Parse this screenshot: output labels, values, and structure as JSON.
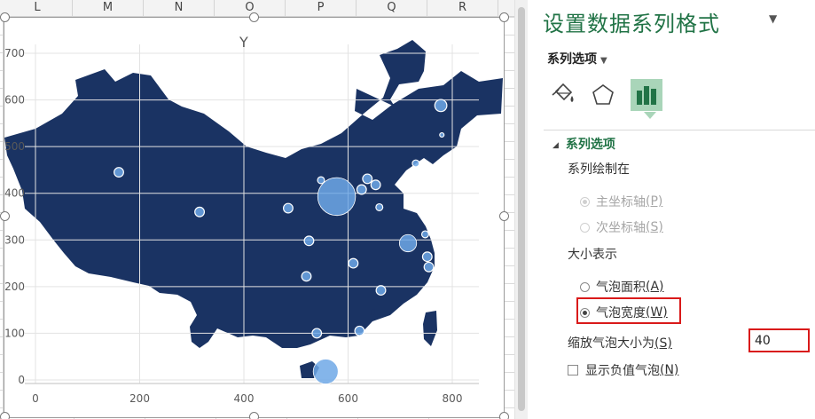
{
  "spreadsheet": {
    "column_headers": [
      "L",
      "M",
      "N",
      "O",
      "P",
      "Q",
      "R"
    ]
  },
  "chart": {
    "title": "Y"
  },
  "chart_data": {
    "type": "scatter",
    "title": "Y",
    "xlabel": "",
    "ylabel": "",
    "xlim": [
      0,
      800
    ],
    "ylim": [
      0,
      700
    ],
    "x_ticks": [
      "0",
      "200",
      "400",
      "600",
      "800"
    ],
    "y_ticks": [
      "0",
      "100",
      "200",
      "300",
      "400",
      "500",
      "600",
      "700"
    ],
    "grid": true,
    "legend": "none",
    "background_image": "china-map",
    "map_color": "#1a3363",
    "bubble_color": "#6fa8e6",
    "points": [
      {
        "x": 160,
        "y": 445,
        "size": 3
      },
      {
        "x": 315,
        "y": 360,
        "size": 3
      },
      {
        "x": 485,
        "y": 368,
        "size": 3
      },
      {
        "x": 525,
        "y": 298,
        "size": 3
      },
      {
        "x": 520,
        "y": 222,
        "size": 3
      },
      {
        "x": 548,
        "y": 428,
        "size": 2
      },
      {
        "x": 578,
        "y": 393,
        "size": 14
      },
      {
        "x": 610,
        "y": 250,
        "size": 3
      },
      {
        "x": 626,
        "y": 408,
        "size": 3
      },
      {
        "x": 637,
        "y": 431,
        "size": 3
      },
      {
        "x": 653,
        "y": 418,
        "size": 3
      },
      {
        "x": 660,
        "y": 370,
        "size": 2
      },
      {
        "x": 663,
        "y": 192,
        "size": 3
      },
      {
        "x": 715,
        "y": 293,
        "size": 6
      },
      {
        "x": 730,
        "y": 464,
        "size": 2
      },
      {
        "x": 752,
        "y": 264,
        "size": 3
      },
      {
        "x": 748,
        "y": 312,
        "size": 2
      },
      {
        "x": 755,
        "y": 242,
        "size": 3
      },
      {
        "x": 778,
        "y": 588,
        "size": 4
      },
      {
        "x": 780,
        "y": 525,
        "size": 1
      },
      {
        "x": 540,
        "y": 100,
        "size": 3
      },
      {
        "x": 622,
        "y": 105,
        "size": 3
      },
      {
        "x": 557,
        "y": 18,
        "size": 9
      }
    ]
  },
  "pane": {
    "title": "设置数据系列格式",
    "options_dropdown": "系列选项",
    "section_header": "系列选项",
    "plot_on_label": "系列绘制在",
    "primary_axis": "主坐标轴",
    "primary_axis_key": "(P)",
    "secondary_axis": "次坐标轴",
    "secondary_axis_key": "(S)",
    "size_represents_label": "大小表示",
    "bubble_area": "气泡面积",
    "bubble_area_key": "(A)",
    "bubble_width": "气泡宽度",
    "bubble_width_key": "(W)",
    "scale_label": "缩放气泡大小为",
    "scale_key": "(S)",
    "scale_value": "40",
    "show_negative": "显示负值气泡",
    "show_negative_key": "(N)"
  },
  "colors": {
    "accent": "#217346",
    "highlight": "#d91a1a",
    "map": "#1a3363",
    "bubble": "#6fa8e6",
    "tab_selected": "#a9d5b9"
  },
  "icons": {
    "fill": "paint-bucket-icon",
    "effects": "pentagon-icon",
    "series": "bar-chart-icon"
  }
}
